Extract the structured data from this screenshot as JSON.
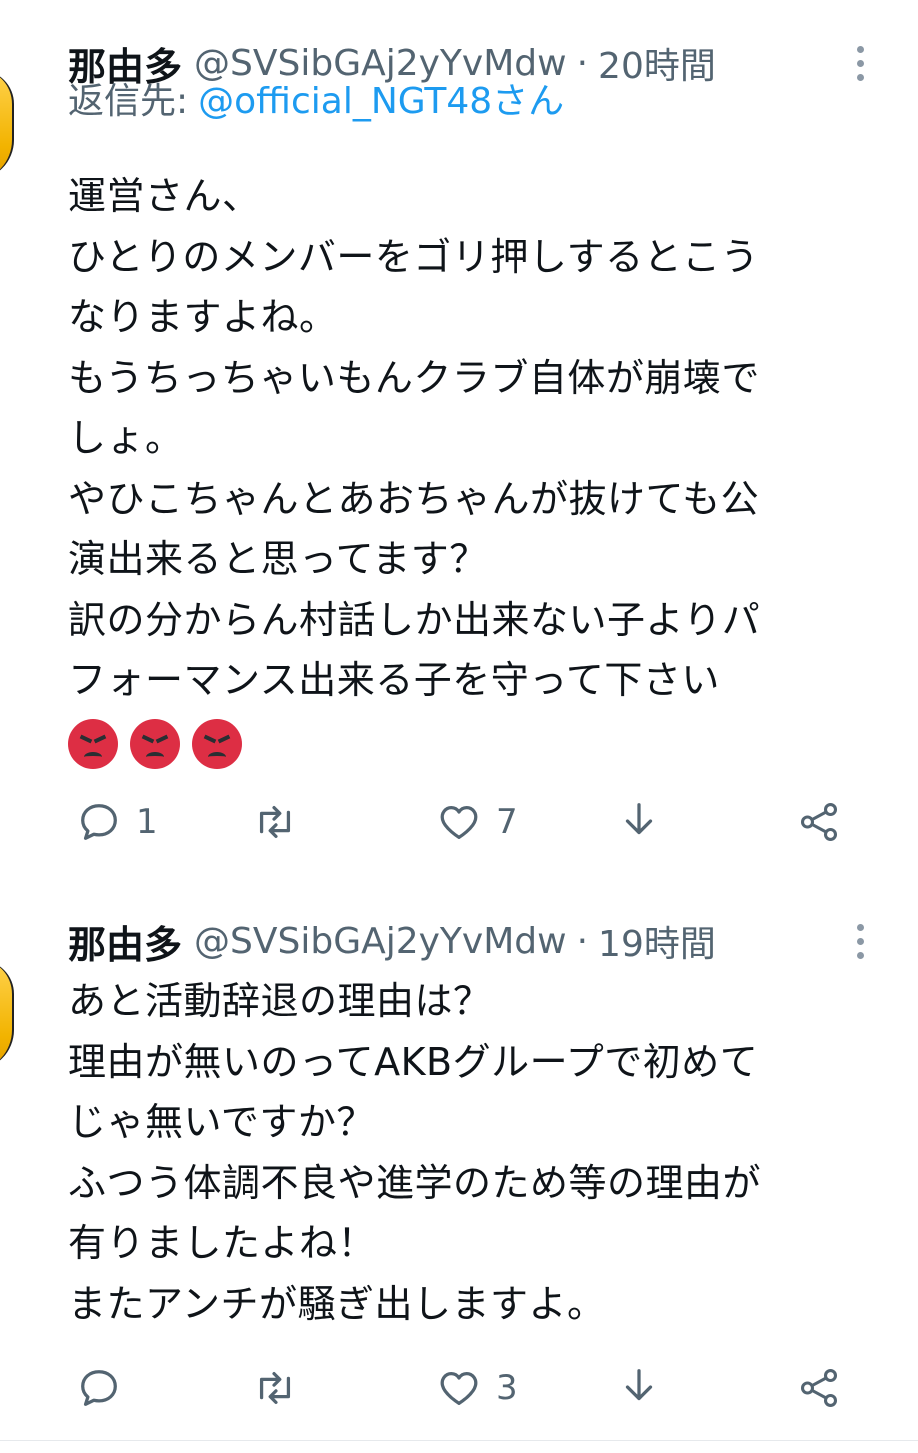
{
  "tweets": [
    {
      "name": "那由多",
      "handle": "@SVSibGAj2yYvMdw",
      "separator": "·",
      "time": "20時間",
      "reply_label": "返信先:",
      "reply_to": "@official_NGT48さん",
      "lines": [
        "運営さん、",
        "ひとりのメンバーをゴリ押しするとこう",
        "なりますよね。",
        "もうちっちゃいもんクラブ自体が崩壊で",
        "しょ。",
        "やひこちゃんとあおちゃんが抜けても公",
        "演出来ると思ってます？",
        "訳の分からん村話しか出来ない子よりパ",
        "フォーマンス出来る子を守って下さい"
      ],
      "emojis": [
        "angry-face",
        "angry-face",
        "angry-face"
      ],
      "reply_count": "1",
      "retweet_count": "",
      "like_count": "7"
    },
    {
      "name": "那由多",
      "handle": "@SVSibGAj2yYvMdw",
      "separator": "·",
      "time": "19時間",
      "lines": [
        "あと活動辞退の理由は？",
        "理由が無いのってAKBグループで初めて",
        "じゃ無いですか？",
        "ふつう体調不良や進学のため等の理由が",
        "有りましたよね！",
        "またアンチが騒ぎ出しますよ。"
      ],
      "reply_count": "",
      "retweet_count": "",
      "like_count": "3"
    }
  ],
  "colors": {
    "text": "#0f1419",
    "secondary": "#536471",
    "link": "#1d9bf0",
    "emoji_red": "#dd2e44"
  },
  "icons": [
    "reply-icon",
    "retweet-icon",
    "like-icon",
    "bookmark-download-icon",
    "share-icon",
    "more-icon"
  ]
}
